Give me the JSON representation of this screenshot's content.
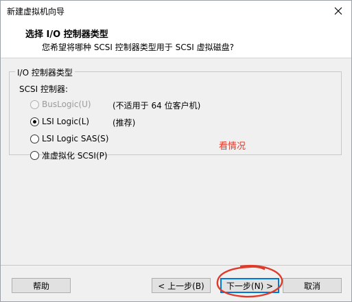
{
  "window": {
    "title": "新建虚拟机向导"
  },
  "header": {
    "title": "选择 I/O 控制器类型",
    "subtitle": "您希望将哪种 SCSI 控制器类型用于 SCSI 虚拟磁盘?"
  },
  "group": {
    "legend": "I/O 控制器类型",
    "sublabel": "SCSI 控制器:",
    "options": [
      {
        "label": "BusLogic(U)",
        "note": "(不适用于 64 位客户机)",
        "state": "disabled"
      },
      {
        "label": "LSI Logic(L)",
        "note": "(推荐)",
        "state": "selected"
      },
      {
        "label": "LSI Logic SAS(S)",
        "note": "",
        "state": "unselected"
      },
      {
        "label": "准虚拟化 SCSI(P)",
        "note": "",
        "state": "unselected"
      }
    ]
  },
  "annotation": {
    "text": "看情况",
    "color": "#e03a2a"
  },
  "footer": {
    "help": "帮助",
    "back": "< 上一步(B)",
    "next": "下一步(N) >",
    "cancel": "取消"
  },
  "colors": {
    "accent": "#0078d7",
    "annotation_red": "#e03a2a"
  },
  "icons": {
    "close": "close-icon"
  }
}
